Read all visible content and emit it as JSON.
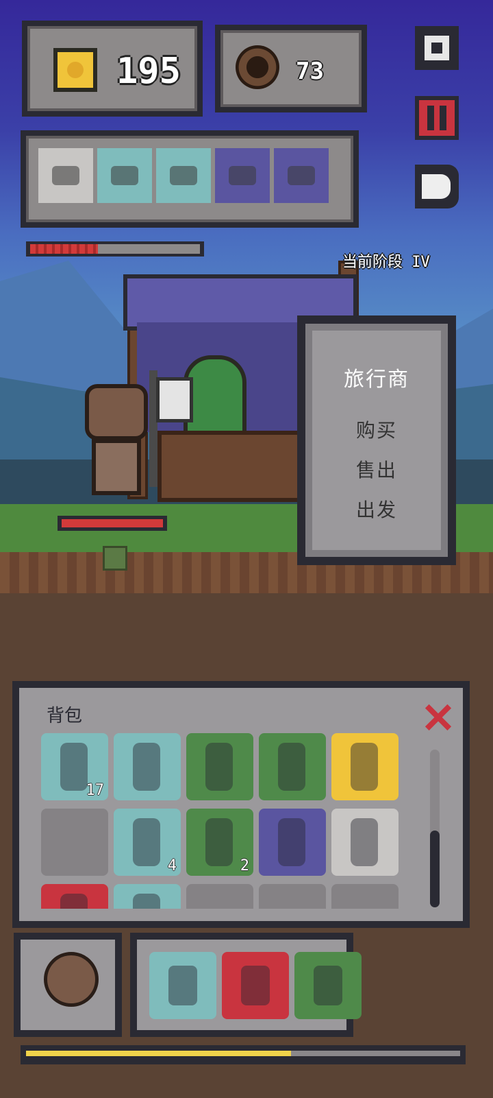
{
  "hud": {
    "gold": "195",
    "resource": "73",
    "settings_icon": "gear-icon",
    "pause_icon": "pause-icon",
    "speed_icon": "speed-icon"
  },
  "equipment_slots": [
    {
      "icon": "barrel-icon",
      "bg": "#c8c6c4"
    },
    {
      "icon": "jaw-trap-icon",
      "bg": "#7fbcbc"
    },
    {
      "icon": "bandage-icon",
      "bg": "#7fbcbc"
    },
    {
      "icon": "bowl-icon",
      "bg": "#5a55a0"
    },
    {
      "icon": "cloth-icon",
      "bg": "#5a55a0"
    }
  ],
  "player_hp": 0.4,
  "stage": "当前阶段 IV",
  "merchant_menu": {
    "title": "旅行商",
    "items": [
      "购买",
      "售出",
      "出发"
    ]
  },
  "inventory": {
    "title": "背包",
    "close_icon": "close-icon",
    "rows": [
      [
        {
          "icon": "salt-pile-icon",
          "bg": "#7fbcbc",
          "count": "17"
        },
        {
          "icon": "vial-icon",
          "bg": "#7fbcbc",
          "count": ""
        },
        {
          "icon": "blue-potion-icon",
          "bg": "#4f8a4a",
          "count": ""
        },
        {
          "icon": "red-potion-icon",
          "bg": "#4f8a4a",
          "count": ""
        },
        {
          "icon": "torch-icon",
          "bg": "#f0c43a",
          "count": ""
        }
      ],
      [
        {
          "icon": "empty",
          "bg": "#858285",
          "count": ""
        },
        {
          "icon": "crystal-icon",
          "bg": "#7fbcbc",
          "count": "4"
        },
        {
          "icon": "dagger-icon",
          "bg": "#4f8a4a",
          "count": "2"
        },
        {
          "icon": "amethyst-icon",
          "bg": "#5a55a0",
          "count": ""
        },
        {
          "icon": "hide-icon",
          "bg": "#c8c6c4",
          "count": ""
        }
      ],
      [
        {
          "icon": "purple-orb-icon",
          "bg": "#c9343f",
          "count": ""
        },
        {
          "icon": "bottle-icon",
          "bg": "#7fbcbc",
          "count": ""
        },
        {
          "icon": "empty",
          "bg": "#858285",
          "count": ""
        },
        {
          "icon": "empty",
          "bg": "#858285",
          "count": ""
        },
        {
          "icon": "empty",
          "bg": "#858285",
          "count": ""
        }
      ]
    ],
    "scroll_position": 0.5
  },
  "hero_portrait_icon": "hero-face-icon",
  "weapon_slots": [
    {
      "icon": "bow-icon",
      "bg": "#7fbcbc"
    },
    {
      "icon": "sword-icon",
      "bg": "#c9343f"
    },
    {
      "icon": "shard-icon",
      "bg": "#4f8a4a"
    }
  ],
  "xp_progress": 0.61
}
